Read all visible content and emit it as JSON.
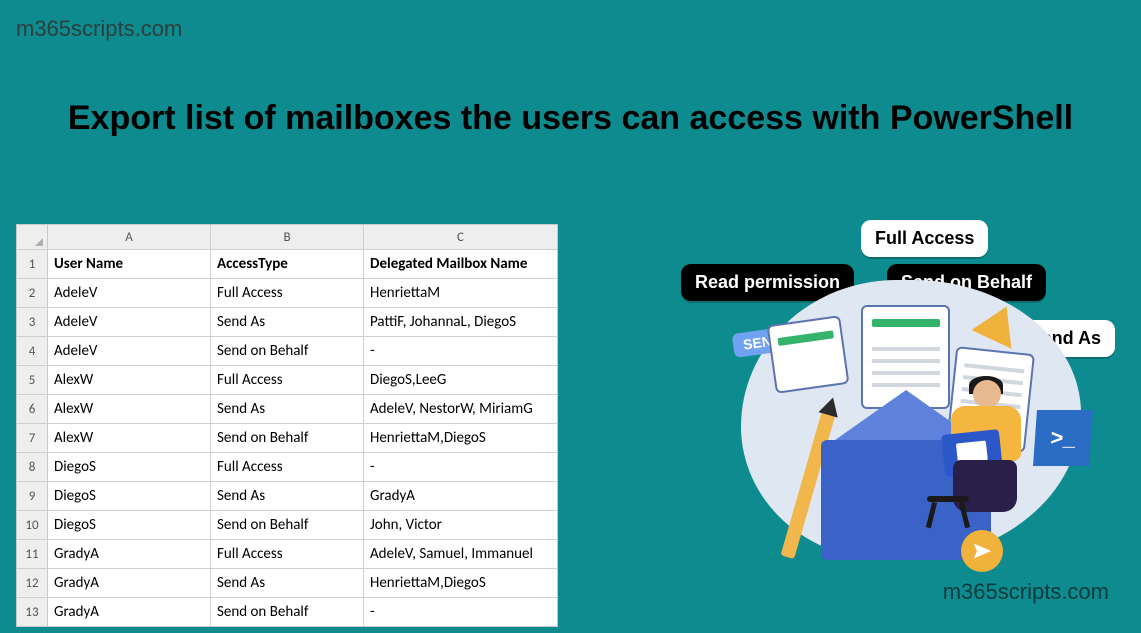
{
  "watermark": "m365scripts.com",
  "title": "Export list of mailboxes the users can access with PowerShell",
  "sheet": {
    "columns": [
      "A",
      "B",
      "C"
    ],
    "headers": [
      "User Name",
      "AccessType",
      "Delegated Mailbox Name"
    ],
    "rows": [
      [
        "AdeleV",
        "Full Access",
        "HenriettaM"
      ],
      [
        "AdeleV",
        "Send As",
        "PattiF, JohannaL, DiegoS"
      ],
      [
        "AdeleV",
        "Send on Behalf",
        "-"
      ],
      [
        "AlexW",
        "Full Access",
        "DiegoS,LeeG"
      ],
      [
        "AlexW",
        "Send As",
        "AdeleV, NestorW, MiriamG"
      ],
      [
        "AlexW",
        "Send on Behalf",
        "HenriettaM,DiegoS"
      ],
      [
        "DiegoS",
        "Full Access",
        "-"
      ],
      [
        "DiegoS",
        "Send As",
        "GradyA"
      ],
      [
        "DiegoS",
        "Send on Behalf",
        "John, Victor"
      ],
      [
        "GradyA",
        "Full Access",
        "AdeleV, Samuel, Immanuel"
      ],
      [
        "GradyA",
        "Send As",
        "HenriettaM,DiegoS"
      ],
      [
        "GradyA",
        "Send on Behalf",
        "-"
      ]
    ]
  },
  "badges": {
    "full_access": "Full Access",
    "read_permission": "Read permission",
    "send_on_behalf": "Send on Behalf",
    "send_as": "Send As"
  },
  "illustration": {
    "send_label": "SEND",
    "powershell_symbol": ">_"
  }
}
